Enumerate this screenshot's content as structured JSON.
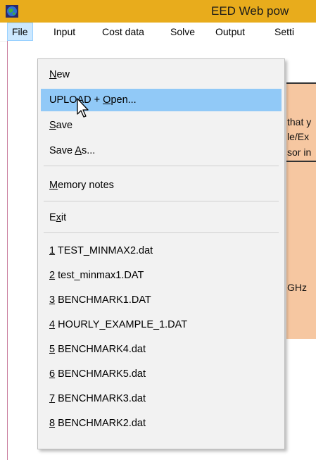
{
  "window": {
    "title": "EED Web pow",
    "accent": "#e8ac1c"
  },
  "menubar": {
    "items": [
      "File",
      "Input",
      "Cost data",
      "Solve",
      "Output",
      "Setti"
    ]
  },
  "background_panel": {
    "lines": [
      "that y",
      "le/Ex",
      "sor in",
      "GHz"
    ]
  },
  "file_menu": {
    "new": {
      "pre": "",
      "ul": "N",
      "post": "ew"
    },
    "upload": {
      "pre": "UPLOAD + ",
      "ul": "O",
      "post": "pen..."
    },
    "save": {
      "pre": "",
      "ul": "S",
      "post": "ave"
    },
    "save_as": {
      "pre": "Save ",
      "ul": "A",
      "post": "s..."
    },
    "memory_notes": {
      "pre": "",
      "ul": "M",
      "post": "emory notes"
    },
    "exit": {
      "pre": "E",
      "ul": "x",
      "post": "it"
    },
    "recent": [
      {
        "num": "1",
        "name": " TEST_MINMAX2.dat"
      },
      {
        "num": "2",
        "name": " test_minmax1.DAT"
      },
      {
        "num": "3",
        "name": " BENCHMARK1.DAT"
      },
      {
        "num": "4",
        "name": " HOURLY_EXAMPLE_1.DAT"
      },
      {
        "num": "5",
        "name": " BENCHMARK4.dat"
      },
      {
        "num": "6",
        "name": " BENCHMARK5.dat"
      },
      {
        "num": "7",
        "name": " BENCHMARK3.dat"
      },
      {
        "num": "8",
        "name": " BENCHMARK2.dat"
      }
    ]
  }
}
